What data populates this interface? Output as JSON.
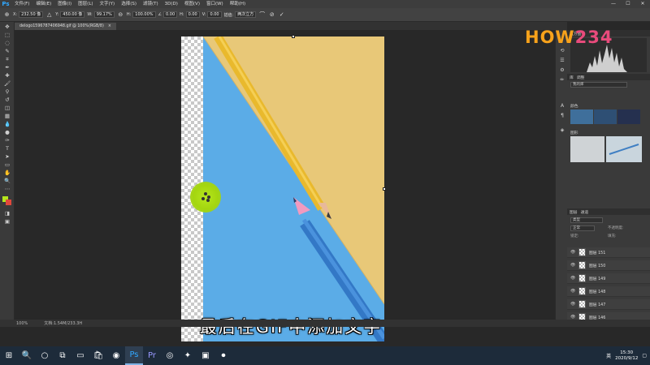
{
  "app": {
    "logo": "Ps"
  },
  "menu": [
    "文件(F)",
    "编辑(E)",
    "图像(I)",
    "图层(L)",
    "文字(Y)",
    "选择(S)",
    "滤镜(T)",
    "3D(D)",
    "视图(V)",
    "窗口(W)",
    "帮助(H)"
  ],
  "window": {
    "minimize": "—",
    "maximize": "☐",
    "close": "✕"
  },
  "options": {
    "tool_glyph": "⊕",
    "x_label": "X:",
    "x_value": "232.50 像",
    "ref_glyph": "△",
    "y_label": "Y:",
    "y_value": "450.00 像",
    "w_label": "W:",
    "w_value": "99.17%",
    "link_glyph": "⊖",
    "h_label": "H:",
    "h_value": "100.00%",
    "angle_label": "∠",
    "angle_value": "0.00",
    "hskew_label": "H:",
    "hskew_value": "0.00",
    "vskew_label": "V:",
    "vskew_value": "0.00",
    "interp_label": "插值:",
    "interp_value": "两次立方",
    "warp_glyph": "⌒",
    "cancel_glyph": "⊘",
    "commit_glyph": "✓"
  },
  "document": {
    "tab_title": "delogo1596787406948.gif @ 100%(RGB/8)",
    "tab_close": "×"
  },
  "tools": [
    "✥",
    "⬚",
    "◌",
    "✎",
    "⌗",
    "✒",
    "✚",
    "🖌",
    "⚲",
    "↺",
    "◫",
    "▦",
    "💧",
    "●",
    "✑",
    "T",
    "➤",
    "▭",
    "✋",
    "🔍",
    "⋯",
    "◨",
    "▣"
  ],
  "subtitle": "最后在GIF中添加文字",
  "status": {
    "zoom": "100%",
    "doc_size": "文档:1.54M/233.3H"
  },
  "panel_icons": [
    "⟲",
    "☰",
    "⚙",
    "✏",
    "A",
    "¶",
    "◈"
  ],
  "panels": {
    "histogram_title": "直方图",
    "libraries_title": "库",
    "adjust_title": "调整",
    "library_name": "我的库",
    "colors_label": "颜色",
    "graphics_label": "图形",
    "layers_title": "图层",
    "channels_title": "通道",
    "filter_label": "类型",
    "blend_mode": "正常",
    "opacity_label": "不透明度:",
    "lock_label": "锁定:",
    "fill_label": "填充:"
  },
  "layers": [
    {
      "eye": "👁",
      "name": "图层 151"
    },
    {
      "eye": "👁",
      "name": "图层 150"
    },
    {
      "eye": "👁",
      "name": "图层 149"
    },
    {
      "eye": "👁",
      "name": "图层 148"
    },
    {
      "eye": "👁",
      "name": "图层 147"
    },
    {
      "eye": "👁",
      "name": "图层 146"
    }
  ],
  "watermark": {
    "part1": "HOW",
    "part2": "234"
  },
  "taskbar": [
    "⊞",
    "🔍",
    "○",
    "⧉",
    "▭",
    "🛍",
    "◉",
    "Ps",
    "Pr",
    "◎",
    "✦",
    "▣",
    "⏺"
  ],
  "tray": {
    "ime": "英",
    "time": "15:30",
    "date": "2020/9/12",
    "notify": "▢"
  },
  "colors": {
    "swatch1": "#3f6f9b",
    "swatch2": "#2e4f74",
    "swatch3": "#25304f",
    "foreground": "#b5e61d",
    "background": "#e0483c",
    "watermark1": "#f7a21b",
    "watermark2": "#e94b7c",
    "ps_tb": "#31a8ff",
    "pr_tb": "#9999ff"
  }
}
